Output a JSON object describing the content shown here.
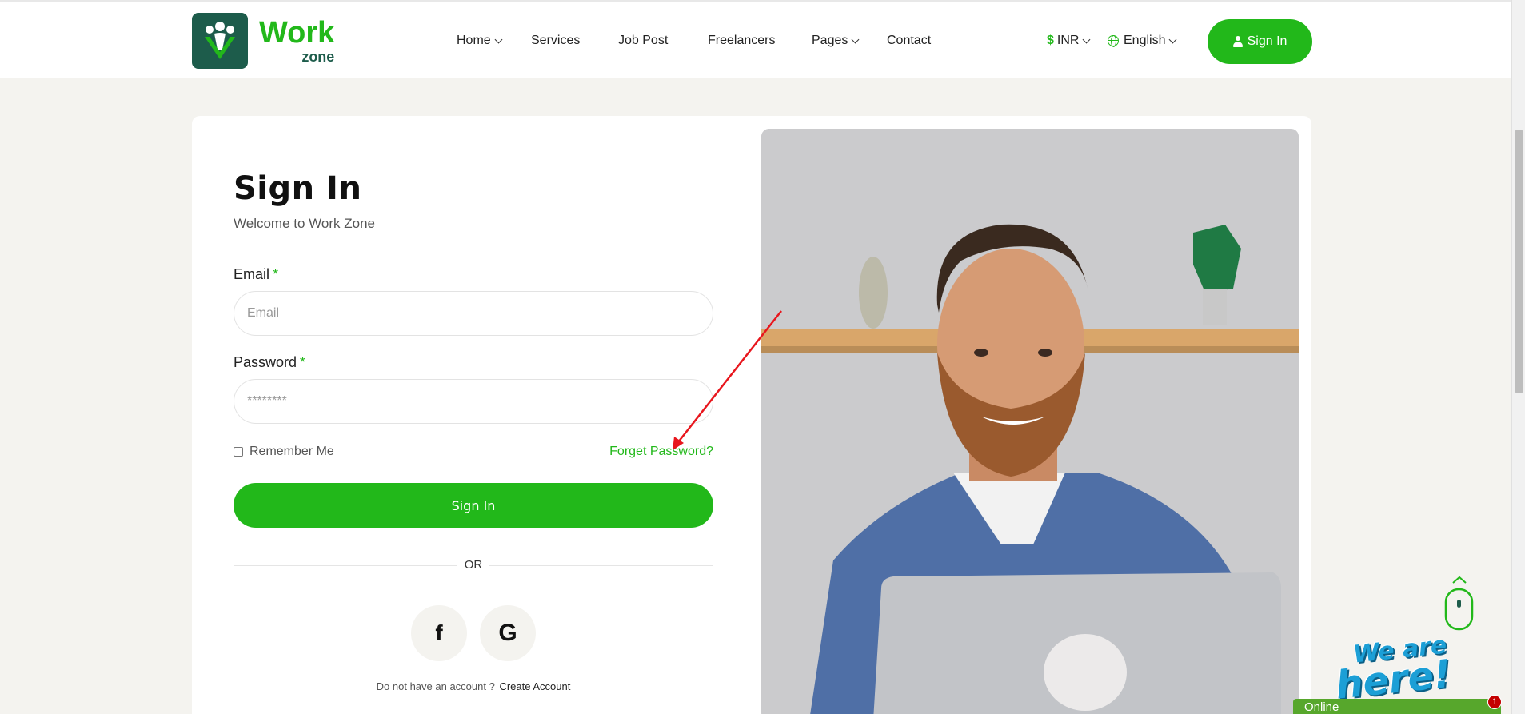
{
  "brand": {
    "word": "Work",
    "sub": "zone"
  },
  "nav": {
    "items": [
      {
        "label": "Home",
        "dropdown": true
      },
      {
        "label": "Services",
        "dropdown": false
      },
      {
        "label": "Job Post",
        "dropdown": false
      },
      {
        "label": "Freelancers",
        "dropdown": false
      },
      {
        "label": "Pages",
        "dropdown": true
      },
      {
        "label": "Contact",
        "dropdown": false
      }
    ],
    "currency": {
      "symbol": "$",
      "label": "INR"
    },
    "language": {
      "label": "English"
    },
    "signin_label": "Sign In"
  },
  "form": {
    "title": "Sign In",
    "subtitle": "Welcome to Work Zone",
    "email_label": "Email",
    "email_placeholder": "Email",
    "password_label": "Password",
    "password_placeholder": "********",
    "required_mark": "*",
    "remember_label": "Remember Me",
    "forget_label": "Forget Password?",
    "submit_label": "Sign In",
    "or_label": "OR",
    "social": {
      "facebook": "f",
      "google": "G"
    },
    "no_account_text": "Do not have an account ?",
    "create_account_label": "Create Account"
  },
  "widget": {
    "online_label": "Online",
    "badge_count": "1",
    "tagline_line1": "We are",
    "tagline_line2": "here!"
  },
  "colors": {
    "accent": "#22b81a",
    "brand_dark": "#1d5c4b",
    "annotation": "#e8161d"
  }
}
